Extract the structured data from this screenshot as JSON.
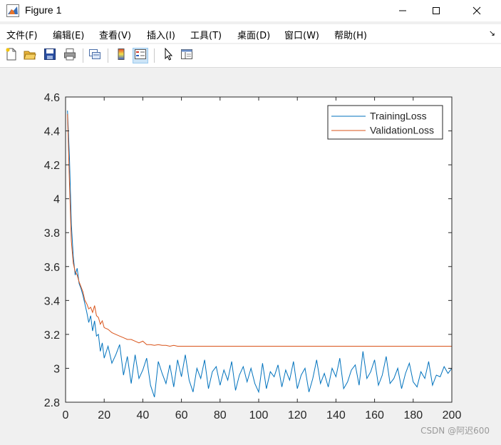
{
  "window": {
    "title": "Figure 1"
  },
  "menu": {
    "items": [
      "文件(F)",
      "编辑(E)",
      "查看(V)",
      "插入(I)",
      "工具(T)",
      "桌面(D)",
      "窗口(W)",
      "帮助(H)"
    ]
  },
  "toolbar": {
    "icons": [
      "new-figure-icon",
      "open-file-icon",
      "save-icon",
      "print-icon",
      "link-plot-icon",
      "colorbar-icon",
      "legend-icon",
      "pointer-icon",
      "property-editor-icon"
    ]
  },
  "watermark": "CSDN @阿迟600",
  "colors": {
    "training": "#0072bd",
    "validation": "#d95319"
  },
  "chart_data": {
    "type": "line",
    "xlim": [
      0,
      200
    ],
    "ylim": [
      2.8,
      4.6
    ],
    "xticks": [
      0,
      20,
      40,
      60,
      80,
      100,
      120,
      140,
      160,
      180,
      200
    ],
    "yticks": [
      2.8,
      3,
      3.2,
      3.4,
      3.6,
      3.8,
      4,
      4.2,
      4.4,
      4.6
    ],
    "xtick_labels": [
      "0",
      "20",
      "40",
      "60",
      "80",
      "100",
      "120",
      "140",
      "160",
      "180",
      "200"
    ],
    "ytick_labels": [
      "2.8",
      "3",
      "3.2",
      "3.4",
      "3.6",
      "3.8",
      "4",
      "4.2",
      "4.4",
      "4.6"
    ],
    "grid": false,
    "legend_position": "top-right",
    "series": [
      {
        "name": "TrainingLoss",
        "x": [
          1,
          2,
          3,
          4,
          5,
          6,
          7,
          8,
          9,
          10,
          11,
          12,
          13,
          14,
          15,
          16,
          17,
          18,
          19,
          20,
          22,
          24,
          26,
          28,
          30,
          32,
          34,
          36,
          38,
          40,
          42,
          44,
          46,
          48,
          50,
          52,
          54,
          56,
          58,
          60,
          62,
          64,
          66,
          68,
          70,
          72,
          74,
          76,
          78,
          80,
          82,
          84,
          86,
          88,
          90,
          92,
          94,
          96,
          98,
          100,
          102,
          104,
          106,
          108,
          110,
          112,
          114,
          116,
          118,
          120,
          122,
          124,
          126,
          128,
          130,
          132,
          134,
          136,
          138,
          140,
          142,
          144,
          146,
          148,
          150,
          152,
          154,
          156,
          158,
          160,
          162,
          164,
          166,
          168,
          170,
          172,
          174,
          176,
          178,
          180,
          182,
          184,
          186,
          188,
          190,
          192,
          194,
          196,
          198,
          200
        ],
        "y": [
          4.52,
          4.25,
          3.85,
          3.66,
          3.55,
          3.59,
          3.5,
          3.47,
          3.43,
          3.38,
          3.33,
          3.27,
          3.31,
          3.22,
          3.28,
          3.19,
          3.2,
          3.1,
          3.15,
          3.06,
          3.13,
          3.03,
          3.08,
          3.14,
          2.96,
          3.07,
          2.91,
          3.08,
          2.94,
          2.99,
          3.06,
          2.9,
          2.83,
          3.04,
          2.97,
          2.91,
          3.02,
          2.89,
          3.05,
          2.95,
          3.08,
          2.93,
          2.86,
          3.0,
          2.94,
          3.05,
          2.88,
          2.98,
          3.01,
          2.9,
          2.99,
          2.93,
          3.04,
          2.87,
          2.96,
          3.01,
          2.92,
          3.0,
          2.91,
          2.86,
          3.03,
          2.88,
          2.98,
          2.95,
          3.02,
          2.89,
          2.99,
          2.93,
          3.04,
          2.88,
          2.96,
          3.0,
          2.86,
          2.94,
          3.05,
          2.91,
          2.97,
          2.89,
          3.0,
          2.95,
          3.06,
          2.88,
          2.92,
          2.99,
          3.02,
          2.9,
          3.1,
          2.94,
          2.98,
          3.05,
          2.9,
          2.96,
          3.07,
          2.91,
          2.94,
          3.0,
          2.88,
          2.97,
          3.03,
          2.92,
          2.89,
          2.98,
          2.94,
          3.04,
          2.9,
          2.96,
          2.95,
          3.01,
          2.97,
          3.0
        ]
      },
      {
        "name": "ValidationLoss",
        "x": [
          1,
          2,
          3,
          4,
          5,
          6,
          7,
          8,
          9,
          10,
          11,
          12,
          13,
          14,
          15,
          16,
          17,
          18,
          19,
          20,
          22,
          24,
          26,
          28,
          30,
          32,
          34,
          36,
          38,
          40,
          42,
          44,
          46,
          48,
          50,
          52,
          54,
          56,
          58,
          60,
          64,
          68,
          72,
          76,
          80,
          90,
          100,
          120,
          140,
          160,
          180,
          200
        ],
        "y": [
          4.5,
          4.1,
          3.75,
          3.62,
          3.57,
          3.55,
          3.51,
          3.48,
          3.45,
          3.4,
          3.38,
          3.35,
          3.36,
          3.33,
          3.37,
          3.31,
          3.3,
          3.26,
          3.28,
          3.24,
          3.23,
          3.21,
          3.2,
          3.19,
          3.18,
          3.17,
          3.17,
          3.16,
          3.15,
          3.16,
          3.14,
          3.14,
          3.135,
          3.14,
          3.135,
          3.135,
          3.13,
          3.135,
          3.13,
          3.13,
          3.13,
          3.13,
          3.13,
          3.13,
          3.13,
          3.13,
          3.13,
          3.13,
          3.13,
          3.13,
          3.13,
          3.13
        ]
      }
    ]
  }
}
